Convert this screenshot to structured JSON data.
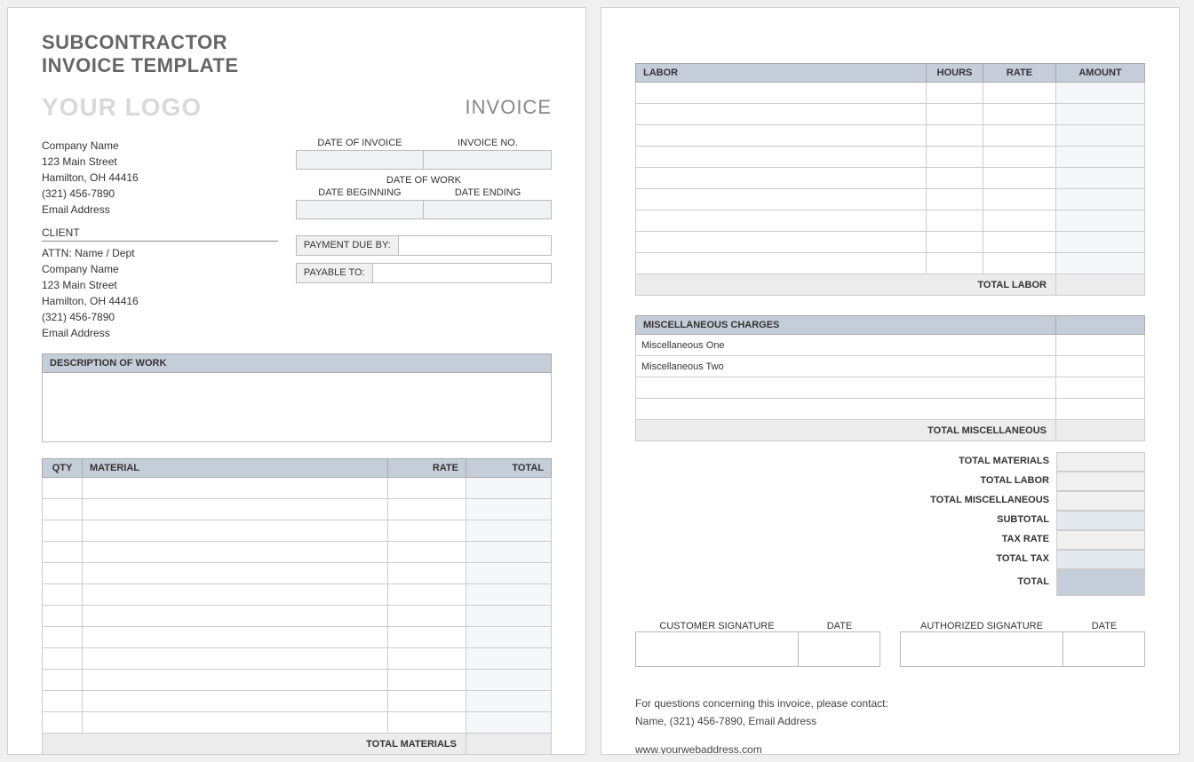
{
  "title": {
    "line1": "SUBCONTRACTOR",
    "line2": "INVOICE TEMPLATE"
  },
  "logo_placeholder": "YOUR LOGO",
  "invoice_word": "INVOICE",
  "headers": {
    "date_of_invoice": "DATE OF INVOICE",
    "invoice_no": "INVOICE NO.",
    "date_of_work": "DATE OF WORK",
    "date_beginning": "DATE BEGINNING",
    "date_ending": "DATE ENDING",
    "payment_due_by": "PAYMENT DUE BY:",
    "payable_to": "PAYABLE TO:",
    "description_of_work": "DESCRIPTION OF WORK",
    "client": "CLIENT"
  },
  "company": {
    "name": "Company Name",
    "street": "123 Main Street",
    "city": "Hamilton, OH  44416",
    "phone": "(321) 456-7890",
    "email": "Email Address"
  },
  "client": {
    "attn": "ATTN: Name / Dept",
    "name": "Company Name",
    "street": "123 Main Street",
    "city": "Hamilton, OH  44416",
    "phone": "(321) 456-7890",
    "email": "Email Address"
  },
  "materials_table": {
    "cols": {
      "qty": "QTY",
      "material": "MATERIAL",
      "rate": "RATE",
      "total": "TOTAL"
    },
    "row_count": 12,
    "footer": "TOTAL MATERIALS"
  },
  "labor_table": {
    "cols": {
      "labor": "LABOR",
      "hours": "HOURS",
      "rate": "RATE",
      "amount": "AMOUNT"
    },
    "row_count": 9,
    "footer": "TOTAL LABOR"
  },
  "misc_table": {
    "header": "MISCELLANEOUS CHARGES",
    "rows": [
      "Miscellaneous One",
      "Miscellaneous Two",
      "",
      ""
    ],
    "footer": "TOTAL MISCELLANEOUS"
  },
  "totals": {
    "materials": "TOTAL MATERIALS",
    "labor": "TOTAL LABOR",
    "misc": "TOTAL MISCELLANEOUS",
    "subtotal": "SUBTOTAL",
    "tax_rate": "TAX RATE",
    "total_tax": "TOTAL TAX",
    "total": "TOTAL"
  },
  "signatures": {
    "customer": "CUSTOMER SIGNATURE",
    "authorized": "AUTHORIZED SIGNATURE",
    "date": "DATE"
  },
  "footer": {
    "line1": "For questions concerning this invoice, please contact:",
    "line2": "Name, (321) 456-7890, Email Address",
    "url": "www.yourwebaddress.com"
  }
}
